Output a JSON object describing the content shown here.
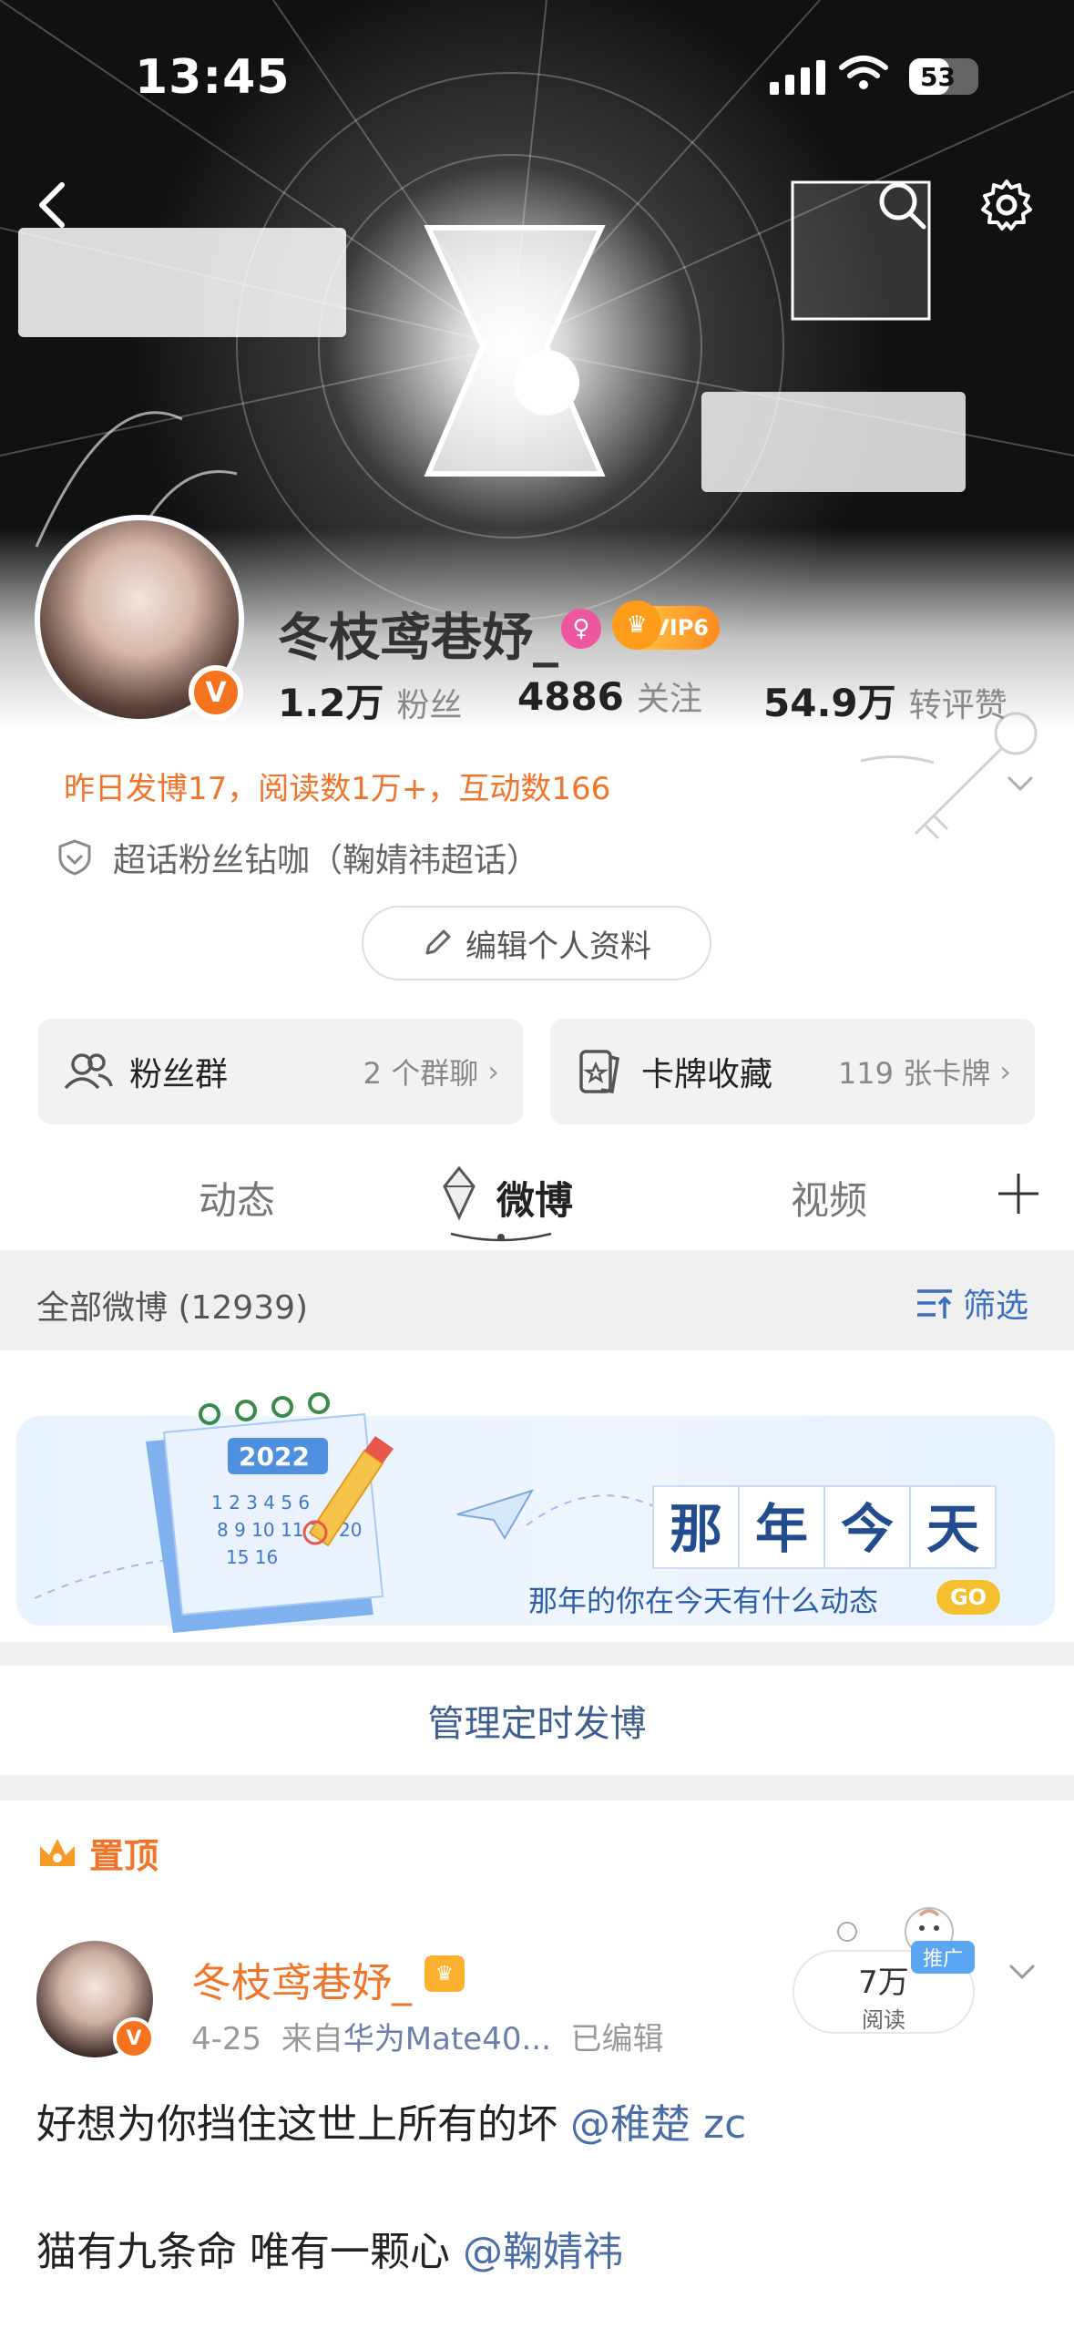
{
  "status_bar": {
    "time": "13:45",
    "battery": "53"
  },
  "profile": {
    "name": "冬枝鸢巷妤_",
    "vip_label": "VIP6",
    "stats": [
      {
        "value": "1.2万",
        "label": "粉丝"
      },
      {
        "value": "4886",
        "label": "关注"
      },
      {
        "value": "54.9万",
        "label": "转评赞"
      }
    ],
    "activity": "昨日发博17，阅读数1万+，互动数166",
    "supertopic": "超话粉丝钻咖（鞠婧祎超话）",
    "edit_button": "编辑个人资料"
  },
  "cards": [
    {
      "title": "粉丝群",
      "count": "2 个群聊"
    },
    {
      "title": "卡牌收藏",
      "count": "119 张卡牌"
    }
  ],
  "tabs": [
    "动态",
    "微博",
    "视频"
  ],
  "active_tab": "微博",
  "filter": {
    "all_label": "全部微博 (12939)",
    "filter_label": "筛选"
  },
  "memory": {
    "title_chars": [
      "那",
      "年",
      "今",
      "天"
    ],
    "subtitle": "那年的你在今天有什么动态",
    "go": "GO",
    "calendar_year": "2022",
    "calendar_numbers": "1 2 3 4 5 6\n8 9 10 11 12\n15 16     20"
  },
  "manage_label": "管理定时发博",
  "post": {
    "pinned_label": "置顶",
    "author": "冬枝鸢巷妤_",
    "date": "4-25",
    "source_prefix": "来自",
    "source": "华为Mate40...",
    "edited": "已编辑",
    "reads": "7万",
    "reads_unit": "阅读",
    "promo": "推广",
    "line1": "好想为你挡住这世上所有的坏 ",
    "mention1": "@稚楚 zc",
    "line2": "猫有九条命 唯有一颗心 ",
    "mention2": "@鞠婧祎"
  },
  "colors": {
    "accent_orange": "#f0742a",
    "link_blue": "#4a6ea8",
    "filter_blue": "#3b6fc0"
  }
}
